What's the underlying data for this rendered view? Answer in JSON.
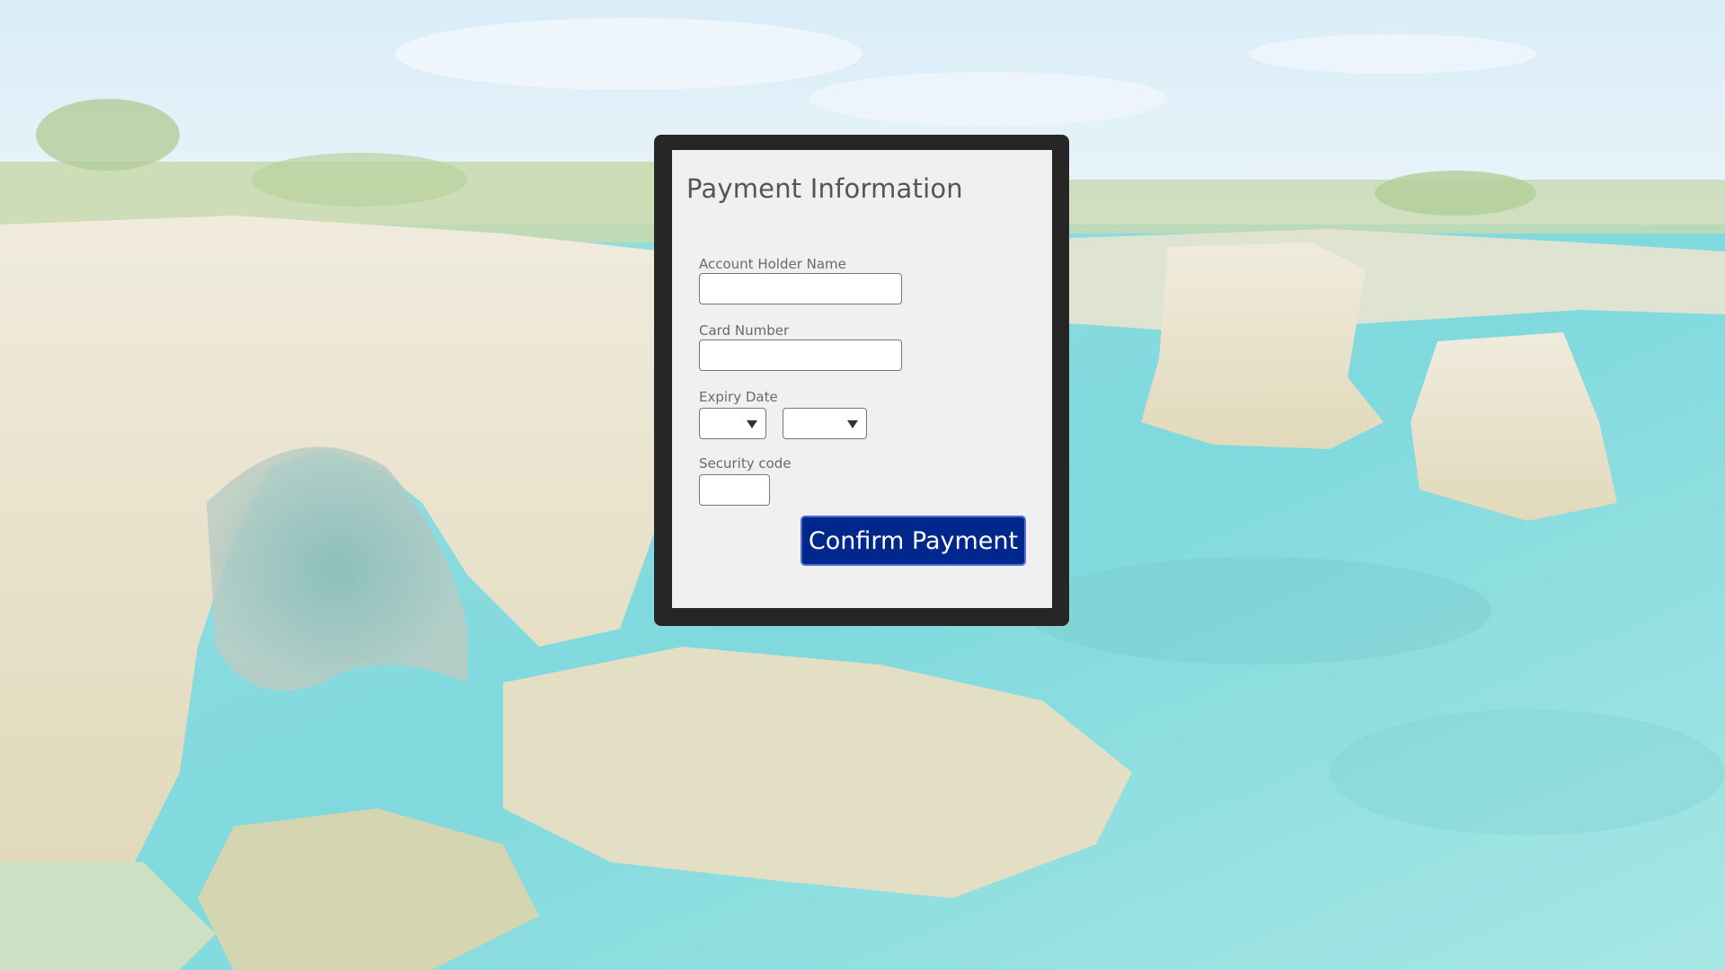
{
  "page": {
    "background_description_icon": "coastal-cliffs-photo",
    "colors": {
      "frame": "#262626",
      "card": "#f0f0f0",
      "button": "#00278c",
      "button_border": "#4f6fd6",
      "label": "#6a6a6a",
      "title": "#555555"
    }
  },
  "form": {
    "title": "Payment Information",
    "account_holder": {
      "label": "Account Holder Name",
      "value": "",
      "placeholder": ""
    },
    "card_number": {
      "label": "Card Number",
      "value": "",
      "placeholder": ""
    },
    "expiry": {
      "label": "Expiry Date",
      "month_value": "",
      "year_value": ""
    },
    "security_code": {
      "label": "Security code",
      "value": "",
      "placeholder": ""
    },
    "confirm_label": "Confirm Payment"
  }
}
